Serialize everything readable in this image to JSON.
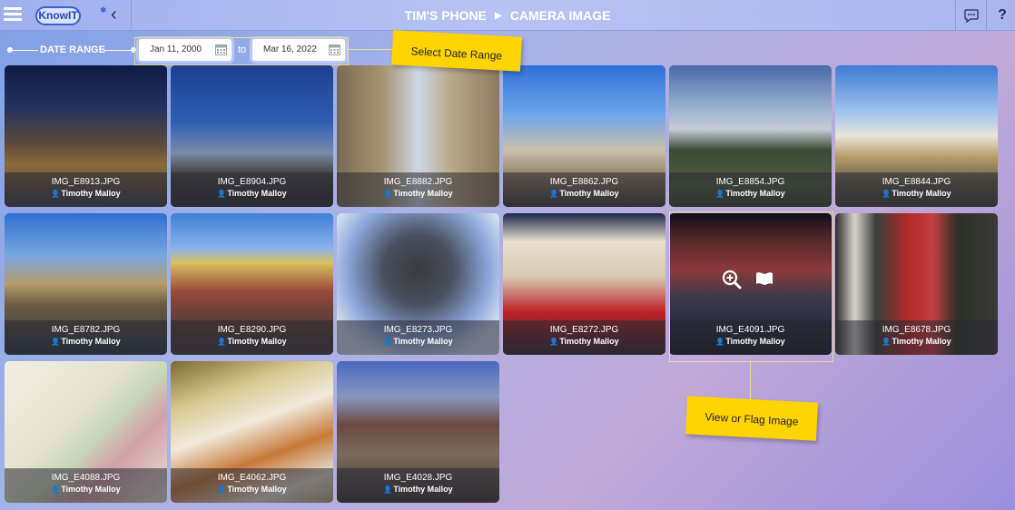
{
  "header": {
    "logo_text": "KnowIT",
    "breadcrumb_device": "TIM'S PHONE",
    "breadcrumb_page": "CAMERA IMAGE",
    "help_label": "?"
  },
  "date_range": {
    "label": "DATE RANGE",
    "start": "Jan 11, 2000",
    "to_label": "to",
    "end": "Mar 16, 2022"
  },
  "callouts": {
    "select_date_range": "Select Date Range",
    "view_or_flag": "View or Flag Image"
  },
  "images": [
    {
      "filename": "IMG_E8913.JPG",
      "owner": "Timothy Malloy"
    },
    {
      "filename": "IMG_E8904.JPG",
      "owner": "Timothy Malloy"
    },
    {
      "filename": "IMG_E8882.JPG",
      "owner": "Timothy Malloy"
    },
    {
      "filename": "IMG_E8862.JPG",
      "owner": "Timothy Malloy"
    },
    {
      "filename": "IMG_E8854.JPG",
      "owner": "Timothy Malloy"
    },
    {
      "filename": "IMG_E8844.JPG",
      "owner": "Timothy Malloy"
    },
    {
      "filename": "IMG_E8782.JPG",
      "owner": "Timothy Malloy"
    },
    {
      "filename": "IMG_E8290.JPG",
      "owner": "Timothy Malloy"
    },
    {
      "filename": "IMG_E8273.JPG",
      "owner": "Timothy Malloy"
    },
    {
      "filename": "IMG_E8272.JPG",
      "owner": "Timothy Malloy"
    },
    {
      "filename": "IMG_E4091.JPG",
      "owner": "Timothy Malloy"
    },
    {
      "filename": "IMG_E8678.JPG",
      "owner": "Timothy Malloy"
    },
    {
      "filename": "IMG_E4088.JPG",
      "owner": "Timothy Malloy"
    },
    {
      "filename": "IMG_E4062.JPG",
      "owner": "Timothy Malloy"
    },
    {
      "filename": "IMG_E4028.JPG",
      "owner": "Timothy Malloy"
    }
  ]
}
